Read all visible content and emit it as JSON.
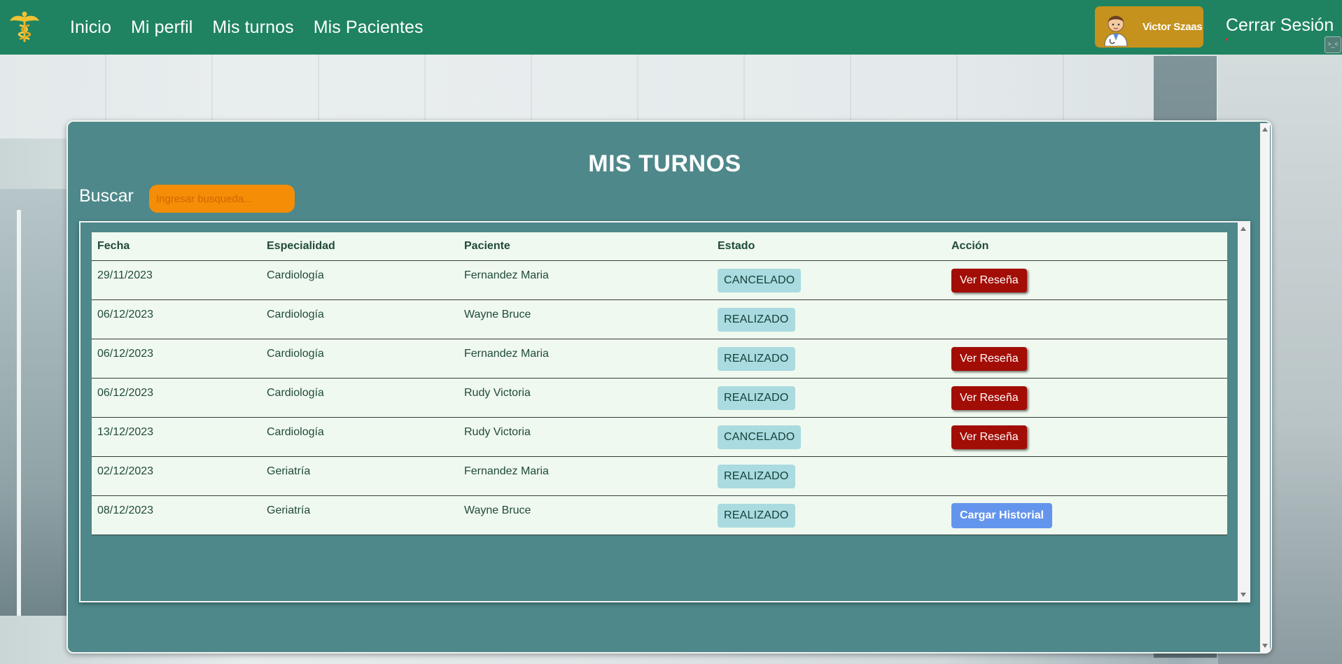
{
  "nav": {
    "links": [
      "Inicio",
      "Mi perfil",
      "Mis turnos",
      "Mis Pacientes"
    ],
    "user_name": "Victor Szaas",
    "logout_label": "Cerrar Sesión",
    "brand_color": "#1f8361",
    "user_chip_color": "#c5921d"
  },
  "panel": {
    "title": "MIS TURNOS",
    "search_label": "Buscar",
    "search_placeholder": "Ingresar busqueda...",
    "search_value": ""
  },
  "table": {
    "headers": [
      "Fecha",
      "Especialidad",
      "Paciente",
      "Estado",
      "Acción"
    ],
    "rows": [
      {
        "fecha": "29/11/2023",
        "especialidad": "Cardiología",
        "paciente": "Fernandez Maria",
        "estado": "CANCELADO",
        "accion": "Ver Reseña",
        "accion_type": "review"
      },
      {
        "fecha": "06/12/2023",
        "especialidad": "Cardiología",
        "paciente": "Wayne Bruce",
        "estado": "REALIZADO",
        "accion": "",
        "accion_type": "none"
      },
      {
        "fecha": "06/12/2023",
        "especialidad": "Cardiología",
        "paciente": "Fernandez Maria",
        "estado": "REALIZADO",
        "accion": "Ver Reseña",
        "accion_type": "review"
      },
      {
        "fecha": "06/12/2023",
        "especialidad": "Cardiología",
        "paciente": "Rudy Victoria",
        "estado": "REALIZADO",
        "accion": "Ver Reseña",
        "accion_type": "review"
      },
      {
        "fecha": "13/12/2023",
        "especialidad": "Cardiología",
        "paciente": "Rudy Victoria",
        "estado": "CANCELADO",
        "accion": "Ver Reseña",
        "accion_type": "review"
      },
      {
        "fecha": "02/12/2023",
        "especialidad": "Geriatría",
        "paciente": "Fernandez Maria",
        "estado": "REALIZADO",
        "accion": "",
        "accion_type": "none"
      },
      {
        "fecha": "08/12/2023",
        "especialidad": "Geriatría",
        "paciente": "Wayne Bruce",
        "estado": "REALIZADO",
        "accion": "Cargar Historial",
        "accion_type": "history"
      }
    ]
  },
  "icons": {
    "logo": "caduceus-icon",
    "avatar": "doctor-avatar"
  },
  "colors": {
    "panel_bg": "#4e888a",
    "search_bg": "#f58d07",
    "badge_bg": "#a9dbe0",
    "review_btn": "#a20d05",
    "history_btn": "#6495ed",
    "table_bg": "#f0f9ef"
  }
}
